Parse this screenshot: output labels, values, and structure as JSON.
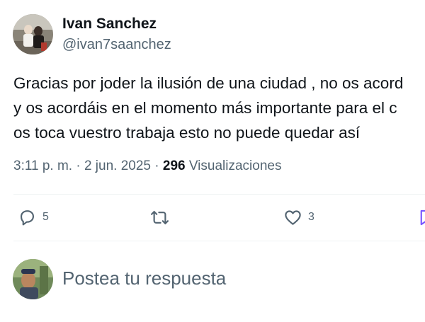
{
  "author": {
    "name": "Ivan Sanchez",
    "handle": "@ivan7saanchez"
  },
  "tweet": {
    "lines": [
      "Gracias por joder la ilusión de una ciudad , no os acord",
      "y os acordáis en el momento más importante para el c",
      "os toca vuestro trabaja esto no puede quedar así"
    ]
  },
  "meta": {
    "time_date": "3:11 p. m. · 2 jun. 2025 · ",
    "views_count": "296",
    "views_label": " Visualizaciones"
  },
  "actions": {
    "reply_count": "5",
    "retweet_count": "",
    "like_count": "3"
  },
  "reply": {
    "placeholder": "Postea tu respuesta"
  },
  "colors": {
    "text_primary": "#0f1419",
    "text_secondary": "#536471",
    "divider": "#eff3f4",
    "bookmark_accent": "#7856ff"
  },
  "icons": {
    "reply": "speech-bubble-icon",
    "retweet": "retweet-arrows-icon",
    "like": "heart-icon",
    "bookmark": "bookmark-icon"
  }
}
